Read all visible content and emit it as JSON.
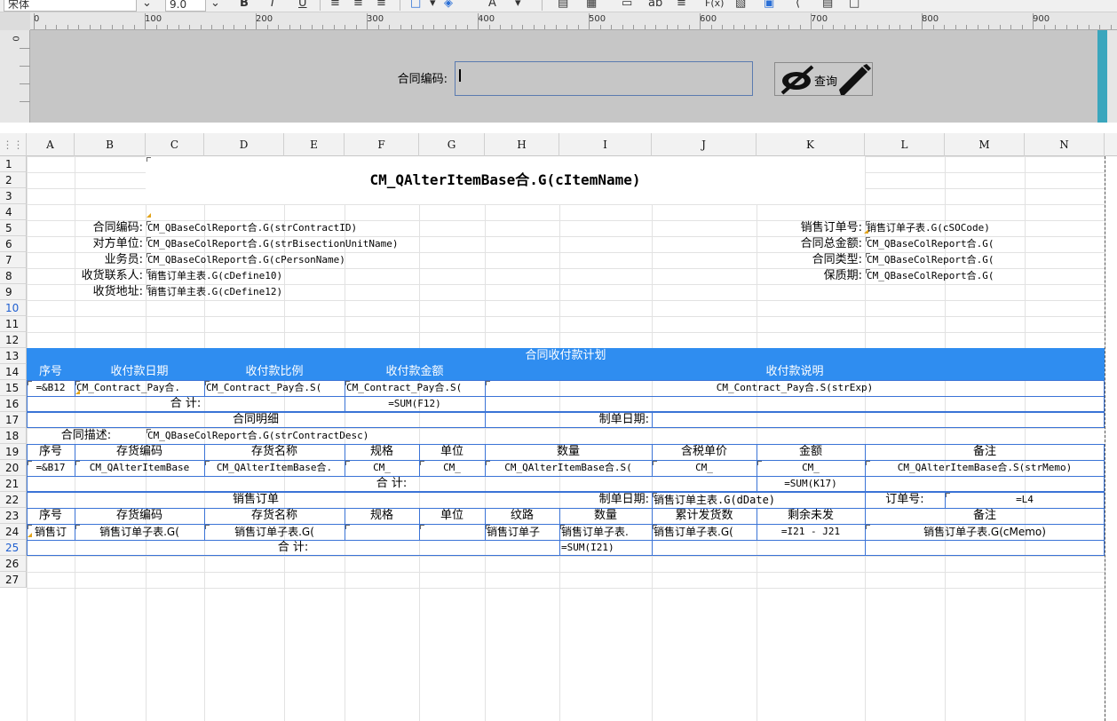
{
  "toolbar": {
    "font_name": "宋体",
    "font_size": "9.0",
    "bold": "B",
    "italic": "I",
    "underline": "U",
    "text_label": "ab",
    "fx_label": "F(x)"
  },
  "ruler": {
    "marks": [
      "0",
      "100",
      "200",
      "300",
      "400",
      "500",
      "600",
      "700",
      "800",
      "900"
    ],
    "vertical_mark": "0"
  },
  "query": {
    "label": "合同编码:",
    "value": "",
    "button_label": "查询"
  },
  "columns": [
    "A",
    "B",
    "C",
    "D",
    "E",
    "F",
    "G",
    "H",
    "I",
    "J",
    "K",
    "L",
    "M",
    "N"
  ],
  "rows": [
    "1",
    "2",
    "3",
    "4",
    "5",
    "6",
    "7",
    "8",
    "9",
    "10",
    "11",
    "12",
    "13",
    "14",
    "15",
    "16",
    "17",
    "18",
    "19",
    "20",
    "21",
    "22",
    "23",
    "24",
    "25",
    "26",
    "27"
  ],
  "report": {
    "title": "CM_QAlterItemBase合.G(cItemName)",
    "header_fields": [
      {
        "label": "合同编码:",
        "value": "CM_QBaseColReport合.G(strContractID)"
      },
      {
        "label": "对方单位:",
        "value": "CM_QBaseColReport合.G(strBisectionUnitName)"
      },
      {
        "label": "业务员:",
        "value": "CM_QBaseColReport合.G(cPersonName)"
      },
      {
        "label": "收货联系人:",
        "value": "销售订单主表.G(cDefine10)"
      },
      {
        "label": "收货地址:",
        "value": "销售订单主表.G(cDefine12)"
      }
    ],
    "right_fields": [
      {
        "label": "销售订单号:",
        "value": "销售订单子表.G(cSOCode)"
      },
      {
        "label": "合同总金额:",
        "value": "CM_QBaseColReport合.G("
      },
      {
        "label": "合同类型:",
        "value": "CM_QBaseColReport合.G("
      },
      {
        "label": "保质期:",
        "value": "CM_QBaseColReport合.G("
      }
    ],
    "plan": {
      "band_title": "合同收付款计划",
      "headers": [
        "序号",
        "收付款日期",
        "收付款比例",
        "收付款金额",
        "收付款说明"
      ],
      "row": [
        "=&B12",
        "CM_Contract_Pay合.",
        "CM_Contract_Pay合.S(",
        "CM_Contract_Pay合.S(",
        "CM_Contract_Pay合.S(strExp)"
      ],
      "total_label": "合  计:",
      "total_value": "=SUM(F12)"
    },
    "detail": {
      "section_label": "合同明细",
      "date_label": "制单日期:",
      "desc_label": "合同描述:",
      "desc_value": "CM_QBaseColReport合.G(strContractDesc)",
      "headers": [
        "序号",
        "存货编码",
        "存货名称",
        "规格",
        "单位",
        "数量",
        "含税单价",
        "金额",
        "备注"
      ],
      "row": [
        "=&B17",
        "CM_QAlterItemBase",
        "CM_QAlterItemBase合.",
        "CM_",
        "CM_",
        "CM_QAlterItemBase合.S(",
        "CM_",
        "CM_",
        "CM_QAlterItemBase合.S(strMemo)"
      ],
      "total_label": "合  计:",
      "total_value": "=SUM(K17)"
    },
    "order": {
      "section_label": "销售订单",
      "date_label": "制单日期:",
      "date_value": "销售订单主表.G(dDate)",
      "order_no_label": "订单号:",
      "order_no_value": "=L4",
      "headers": [
        "序号",
        "存货编码",
        "存货名称",
        "规格",
        "单位",
        "纹路",
        "数量",
        "累计发货数",
        "剩余未发",
        "备注"
      ],
      "row": [
        "销售订",
        "销售订单子表.G(",
        "销售订单子表.G(",
        "",
        "",
        "销售订单子",
        "销售订单子表.",
        "销售订单子表.G(",
        "=I21 - J21",
        "销售订单子表.G(cMemo)"
      ],
      "total_label": "合  计:",
      "total_value": "=SUM(I21)"
    }
  }
}
